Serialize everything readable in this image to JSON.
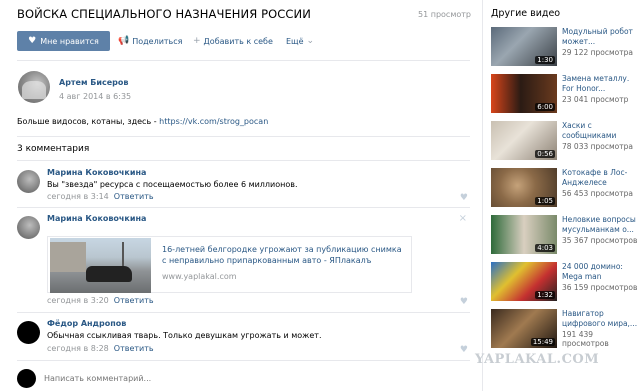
{
  "video": {
    "title": "ВОЙСКА СПЕЦИАЛЬНОГО НАЗНАЧЕНИЯ РОССИИ",
    "views": "51 просмотр"
  },
  "actions": {
    "like": "Мне нравится",
    "share": "Поделиться",
    "add": "Добавить к себе",
    "more": "Ещё"
  },
  "author": {
    "name": "Артем Бисеров",
    "date": "4 авг 2014 в 6:35"
  },
  "description": {
    "text": "Больше видосов, котаны, здесь - ",
    "link": "https://vk.com/strog_pocan"
  },
  "comments": {
    "title": "3 комментария",
    "reply_label": "Ответить",
    "items": [
      {
        "name": "Марина Коковочкина",
        "text": "Вы \"звезда\" ресурса с посещаемостью более 6 миллионов.",
        "time": "сегодня в 3:14"
      },
      {
        "name": "Марина Коковочкина",
        "link_title": "16-летней белгородке угрожают за публикацию снимка с неправильно припаркованным авто - ЯПлакалъ",
        "link_domain": "www.yaplakal.com",
        "time": "сегодня в 3:20"
      },
      {
        "name": "Фёдор Андропов",
        "text": "Обычная ссыкливая тварь. Только девушкам угрожать и может.",
        "time": "сегодня в 8:28"
      }
    ]
  },
  "comment_input": {
    "placeholder": "Написать комментарий..."
  },
  "sidebar": {
    "title": "Другие видео",
    "videos": [
      {
        "title": "Модульный робот может...",
        "views": "29 122 просмотра",
        "duration": "1:30"
      },
      {
        "title": "Замена металлу. For Honor...",
        "views": "23 041 просмотр",
        "duration": "6:00"
      },
      {
        "title": "Хаски с сообщниками едв...",
        "views": "78 033 просмотра",
        "duration": "0:56"
      },
      {
        "title": "Котокафе в Лос-Анджелесе",
        "views": "56 453 просмотра",
        "duration": "1:05"
      },
      {
        "title": "Неловкие вопросы мусульманкам о...",
        "views": "35 367 просмотров",
        "duration": "4:03"
      },
      {
        "title": "24 000 домино: Mega man",
        "views": "36 159 просмотров",
        "duration": "1:32"
      },
      {
        "title": "Навигатор цифрового мира,...",
        "views": "191 439 просмотров",
        "duration": "15:49"
      }
    ]
  },
  "watermark": "YAPLAKAL.COM",
  "colors": {
    "link": "#2a5885",
    "button": "#5e81a8",
    "muted": "#939699"
  }
}
